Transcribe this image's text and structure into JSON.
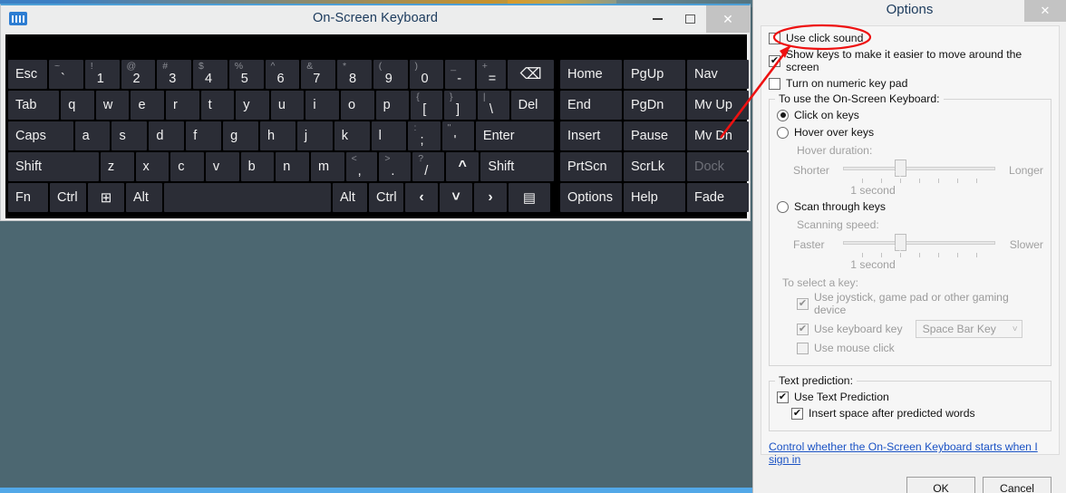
{
  "keyboard_window": {
    "title": "On-Screen Keyboard",
    "app_icon": "keyboard-icon",
    "window_buttons": {
      "minimize": "minimize-icon",
      "maximize": "maximize-icon",
      "close": "✕"
    },
    "rows": [
      [
        {
          "label": "Esc",
          "w": 48
        },
        {
          "sub": "~",
          "main": "`",
          "w": 42
        },
        {
          "sub": "!",
          "main": "1",
          "w": 42
        },
        {
          "sub": "@",
          "main": "2",
          "w": 42
        },
        {
          "sub": "#",
          "main": "3",
          "w": 42
        },
        {
          "sub": "$",
          "main": "4",
          "w": 42
        },
        {
          "sub": "%",
          "main": "5",
          "w": 42
        },
        {
          "sub": "^",
          "main": "6",
          "w": 42
        },
        {
          "sub": "&",
          "main": "7",
          "w": 42
        },
        {
          "sub": "*",
          "main": "8",
          "w": 42
        },
        {
          "sub": "(",
          "main": "9",
          "w": 42
        },
        {
          "sub": ")",
          "main": "0",
          "w": 42
        },
        {
          "sub": "_",
          "main": "-",
          "w": 36
        },
        {
          "sub": "+",
          "main": "=",
          "w": 36
        },
        {
          "label": "⌫",
          "w": 58,
          "icon": "backspace-icon"
        }
      ],
      [
        {
          "label": "Tab",
          "w": 62
        },
        {
          "label": "q",
          "w": 40
        },
        {
          "label": "w",
          "w": 40
        },
        {
          "label": "e",
          "w": 40
        },
        {
          "label": "r",
          "w": 40
        },
        {
          "label": "t",
          "w": 40
        },
        {
          "label": "y",
          "w": 40
        },
        {
          "label": "u",
          "w": 40
        },
        {
          "label": "i",
          "w": 40
        },
        {
          "label": "o",
          "w": 40
        },
        {
          "label": "p",
          "w": 40
        },
        {
          "sub": "{",
          "main": "[",
          "w": 38
        },
        {
          "sub": "}",
          "main": "]",
          "w": 38
        },
        {
          "sub": "|",
          "main": "\\",
          "w": 38
        },
        {
          "label": "Del",
          "w": 52
        }
      ],
      [
        {
          "label": "Caps",
          "w": 78
        },
        {
          "label": "a",
          "w": 42
        },
        {
          "label": "s",
          "w": 42
        },
        {
          "label": "d",
          "w": 42
        },
        {
          "label": "f",
          "w": 42
        },
        {
          "label": "g",
          "w": 42
        },
        {
          "label": "h",
          "w": 42
        },
        {
          "label": "j",
          "w": 42
        },
        {
          "label": "k",
          "w": 42
        },
        {
          "label": "l",
          "w": 42
        },
        {
          "sub": ":",
          "main": ";",
          "w": 38
        },
        {
          "sub": "\"",
          "main": "'",
          "w": 38
        },
        {
          "label": "Enter",
          "w": 94
        }
      ],
      [
        {
          "label": "Shift",
          "w": 104
        },
        {
          "label": "z",
          "w": 38
        },
        {
          "label": "x",
          "w": 38
        },
        {
          "label": "c",
          "w": 38
        },
        {
          "label": "v",
          "w": 38
        },
        {
          "label": "b",
          "w": 38
        },
        {
          "label": "n",
          "w": 38
        },
        {
          "label": "m",
          "w": 38
        },
        {
          "sub": "<",
          "main": ",",
          "w": 36
        },
        {
          "sub": ">",
          "main": ".",
          "w": 36
        },
        {
          "sub": "?",
          "main": "/",
          "w": 36
        },
        {
          "label": "^",
          "w": 38,
          "icon": "arrow-up-icon"
        },
        {
          "label": "Shift",
          "w": 84
        }
      ],
      [
        {
          "label": "Fn",
          "w": 44
        },
        {
          "label": "Ctrl",
          "w": 40
        },
        {
          "label": "⊞",
          "w": 40,
          "icon": "windows-icon"
        },
        {
          "label": "Alt",
          "w": 40
        },
        {
          "label": "",
          "w": 184,
          "icon": "space-bar"
        },
        {
          "label": "Alt",
          "w": 38
        },
        {
          "label": "Ctrl",
          "w": 38
        },
        {
          "label": "‹",
          "w": 36,
          "icon": "arrow-left-icon"
        },
        {
          "label": "˅",
          "w": 36,
          "icon": "arrow-down-icon"
        },
        {
          "label": "›",
          "w": 36,
          "icon": "arrow-right-icon"
        },
        {
          "label": "▤",
          "w": 46,
          "icon": "menu-key-icon"
        }
      ]
    ],
    "nav_rows": [
      [
        {
          "label": "Home"
        },
        {
          "label": "PgUp"
        },
        {
          "label": "Nav"
        }
      ],
      [
        {
          "label": "End"
        },
        {
          "label": "PgDn"
        },
        {
          "label": "Mv Up"
        }
      ],
      [
        {
          "label": "Insert"
        },
        {
          "label": "Pause"
        },
        {
          "label": "Mv Dn"
        }
      ],
      [
        {
          "label": "PrtScn"
        },
        {
          "label": "ScrLk"
        },
        {
          "label": "Dock",
          "dim": true
        }
      ],
      [
        {
          "label": "Options"
        },
        {
          "label": "Help"
        },
        {
          "label": "Fade"
        }
      ]
    ]
  },
  "options_dialog": {
    "title": "Options",
    "close_label": "✕",
    "checkboxes_top": [
      {
        "label": "Use click sound",
        "checked": false
      },
      {
        "label": "Show keys to make it easier to move around the screen",
        "checked": true
      },
      {
        "label": "Turn on numeric key pad",
        "checked": false
      }
    ],
    "usage_group": {
      "legend": "To use the On-Screen Keyboard:",
      "radios": [
        {
          "label": "Click on keys",
          "selected": true
        },
        {
          "label": "Hover over keys",
          "selected": false
        },
        {
          "label": "Scan through keys",
          "selected": false
        }
      ],
      "hover": {
        "label": "Hover duration:",
        "left": "Shorter",
        "right": "Longer",
        "value": "1 second",
        "ticks": 7,
        "thumb_index": 2
      },
      "scanning": {
        "label": "Scanning speed:",
        "left": "Faster",
        "right": "Slower",
        "value": "1 second",
        "ticks": 7,
        "thumb_index": 2
      },
      "select_key": {
        "label": "To select a key:",
        "items": [
          {
            "label": "Use joystick, game pad or other gaming device",
            "checked": true
          },
          {
            "label": "Use keyboard key",
            "checked": true,
            "dropdown": "Space Bar Key"
          },
          {
            "label": "Use mouse click",
            "checked": false
          }
        ]
      }
    },
    "text_prediction": {
      "legend": "Text prediction:",
      "items": [
        {
          "label": "Use Text Prediction",
          "checked": true,
          "indent": 0
        },
        {
          "label": "Insert space after predicted words",
          "checked": true,
          "indent": 1
        }
      ]
    },
    "link": "Control whether the On-Screen Keyboard starts when I sign in",
    "buttons": [
      {
        "label": "OK"
      },
      {
        "label": "Cancel"
      }
    ]
  },
  "annotations": {
    "highlight_color": "#ee1111",
    "ellipse_target": "Use click sound",
    "arrow_from": "Mv Up key",
    "arrow_to": "Use click sound checkbox"
  }
}
